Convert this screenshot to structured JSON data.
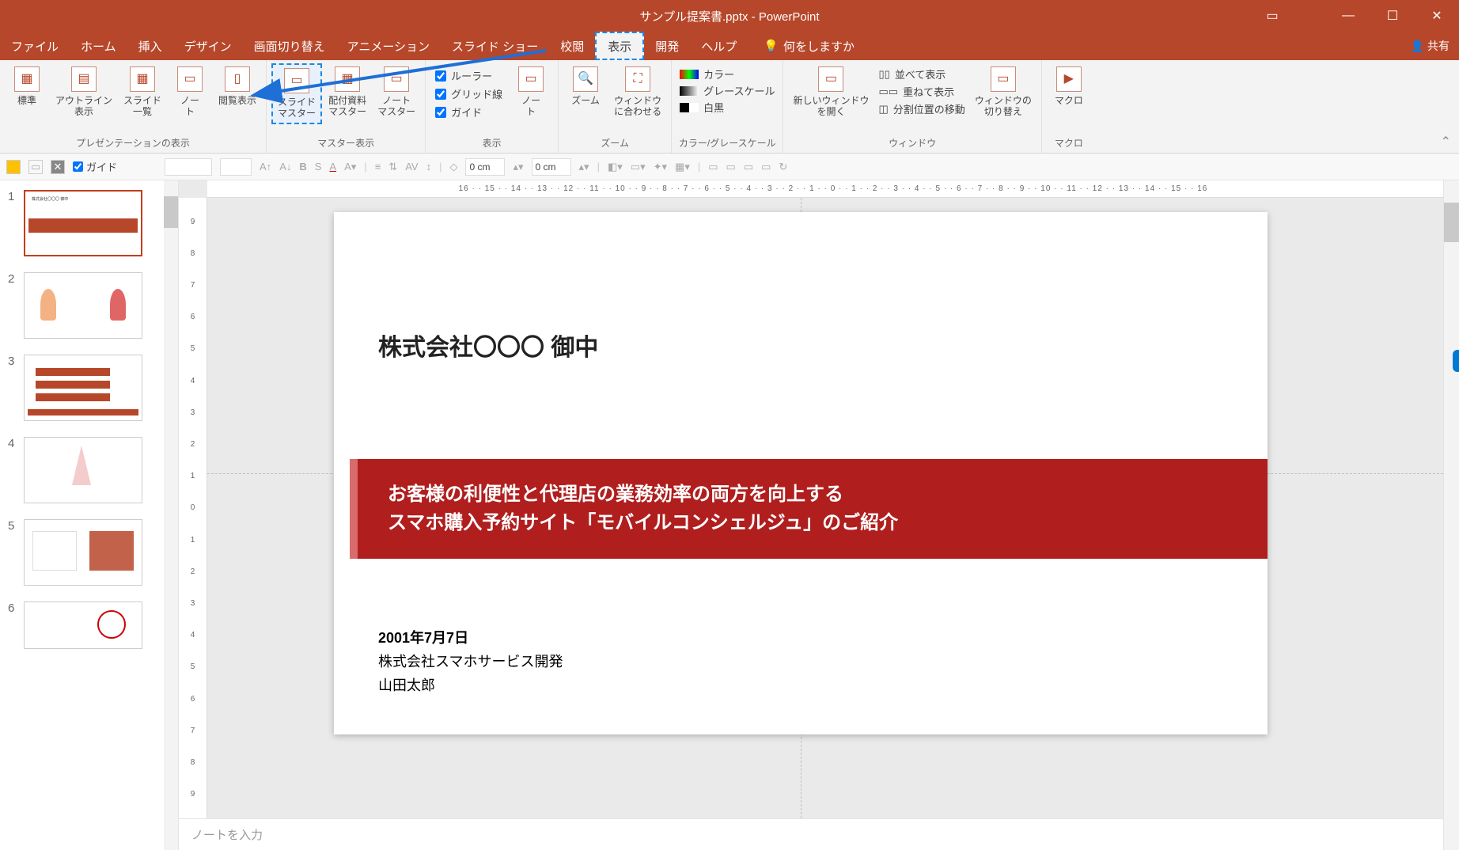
{
  "app": {
    "title": "サンプル提案書.pptx  -  PowerPoint"
  },
  "menu": {
    "file": "ファイル",
    "home": "ホーム",
    "insert": "挿入",
    "design": "デザイン",
    "transitions": "画面切り替え",
    "animations": "アニメーション",
    "slideshow": "スライド ショー",
    "review": "校閲",
    "view": "表示",
    "developer": "開発",
    "help": "ヘルプ",
    "tellme": "何をしますか",
    "share": "共有"
  },
  "ribbon": {
    "g1": {
      "label": "プレゼンテーションの表示",
      "normal": "標準",
      "outline": "アウトライン\n表示",
      "sorter": "スライド\n一覧",
      "notes": "ノー\nト",
      "reading": "閲覧表示"
    },
    "g2": {
      "label": "マスター表示",
      "slide_master": "スライド\nマスター",
      "handout": "配付資料\nマスター",
      "notes_master": "ノート\nマスター"
    },
    "g3": {
      "label": "表示",
      "ruler": "ルーラー",
      "gridlines": "グリッド線",
      "guides": "ガイド",
      "notes_btn": "ノー\nト"
    },
    "g4": {
      "label": "ズーム",
      "zoom": "ズーム",
      "fit": "ウィンドウ\nに合わせる"
    },
    "g5": {
      "label": "カラー/グレースケール",
      "color": "カラー",
      "gray": "グレースケール",
      "bw": "白黒"
    },
    "g6": {
      "label": "ウィンドウ",
      "new_win": "新しいウィンドウ\nを開く",
      "arrange": "並べて表示",
      "cascade": "重ねて表示",
      "split": "分割位置の移動",
      "switch": "ウィンドウの\n切り替え"
    },
    "g7": {
      "label": "マクロ",
      "macro": "マクロ"
    }
  },
  "toolbar2": {
    "guide_chk": "ガイド",
    "len1": "0 cm",
    "len2": "0 cm"
  },
  "ruler_h": "16 · · 15 · · 14 · · 13 · · 12 · · 11 · · 10 · · 9 · · 8 · · 7 · · 6 · · 5 · · 4 · · 3 · · 2 · · 1 · · 0 · · 1 · · 2 · · 3 · · 4 · · 5 · · 6 · · 7 · · 8 · · 9 · · 10 · · 11 · · 12 · · 13 · · 14 · · 15 · · 16",
  "ruler_v": [
    "9",
    "8",
    "7",
    "6",
    "5",
    "4",
    "3",
    "2",
    "1",
    "0",
    "1",
    "2",
    "3",
    "4",
    "5",
    "6",
    "7",
    "8",
    "9"
  ],
  "slide": {
    "client": "株式会社〇〇〇 御中",
    "title1": "お客様の利便性と代理店の業務効率の両方を向上する",
    "title2": "スマホ購入予約サイト「モバイルコンシェルジュ」のご紹介",
    "date": "2001年7月7日",
    "company": "株式会社スマホサービス開発",
    "author": "山田太郎"
  },
  "thumbnails": {
    "count": 6
  },
  "notes": {
    "placeholder": "ノートを入力"
  }
}
